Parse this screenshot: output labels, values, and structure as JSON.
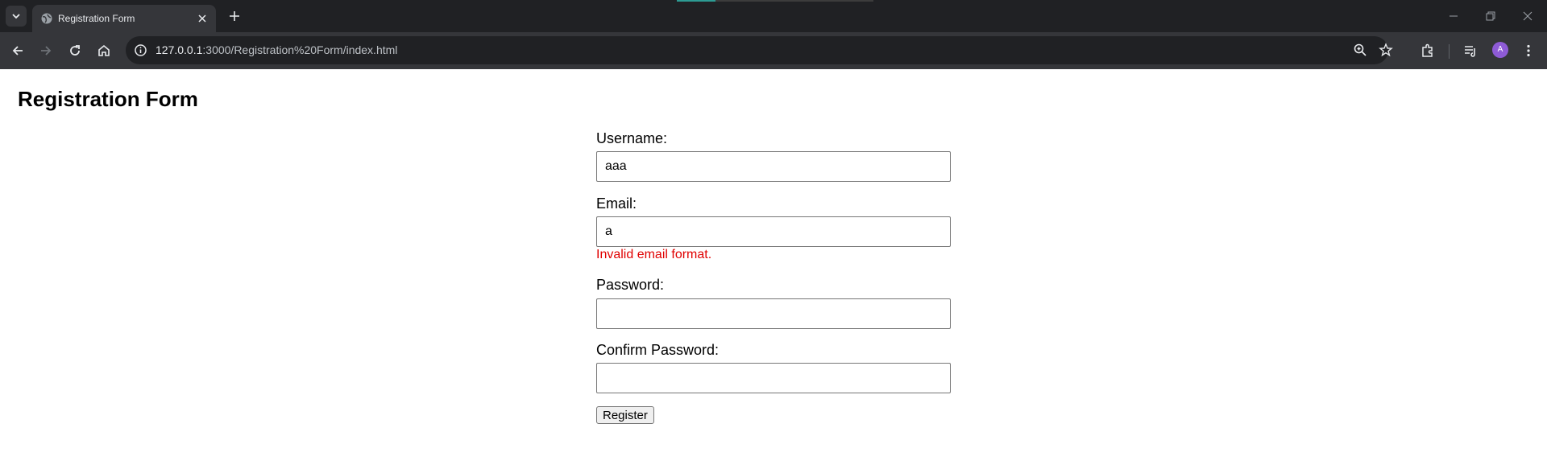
{
  "browser": {
    "tab_title": "Registration Form",
    "url_host": "127.0.0.1",
    "url_rest": ":3000/Registration%20Form/index.html",
    "avatar_letter": "A",
    "accent_color": "#2d9b93",
    "avatar_color": "#8e5bd6"
  },
  "page": {
    "title": "Registration Form"
  },
  "form": {
    "username": {
      "label": "Username:",
      "value": "aaa"
    },
    "email": {
      "label": "Email:",
      "value": "a",
      "error": "Invalid email format.",
      "error_color": "#e00000"
    },
    "password": {
      "label": "Password:",
      "value": ""
    },
    "confirm_password": {
      "label": "Confirm Password:",
      "value": ""
    },
    "submit_label": "Register"
  }
}
